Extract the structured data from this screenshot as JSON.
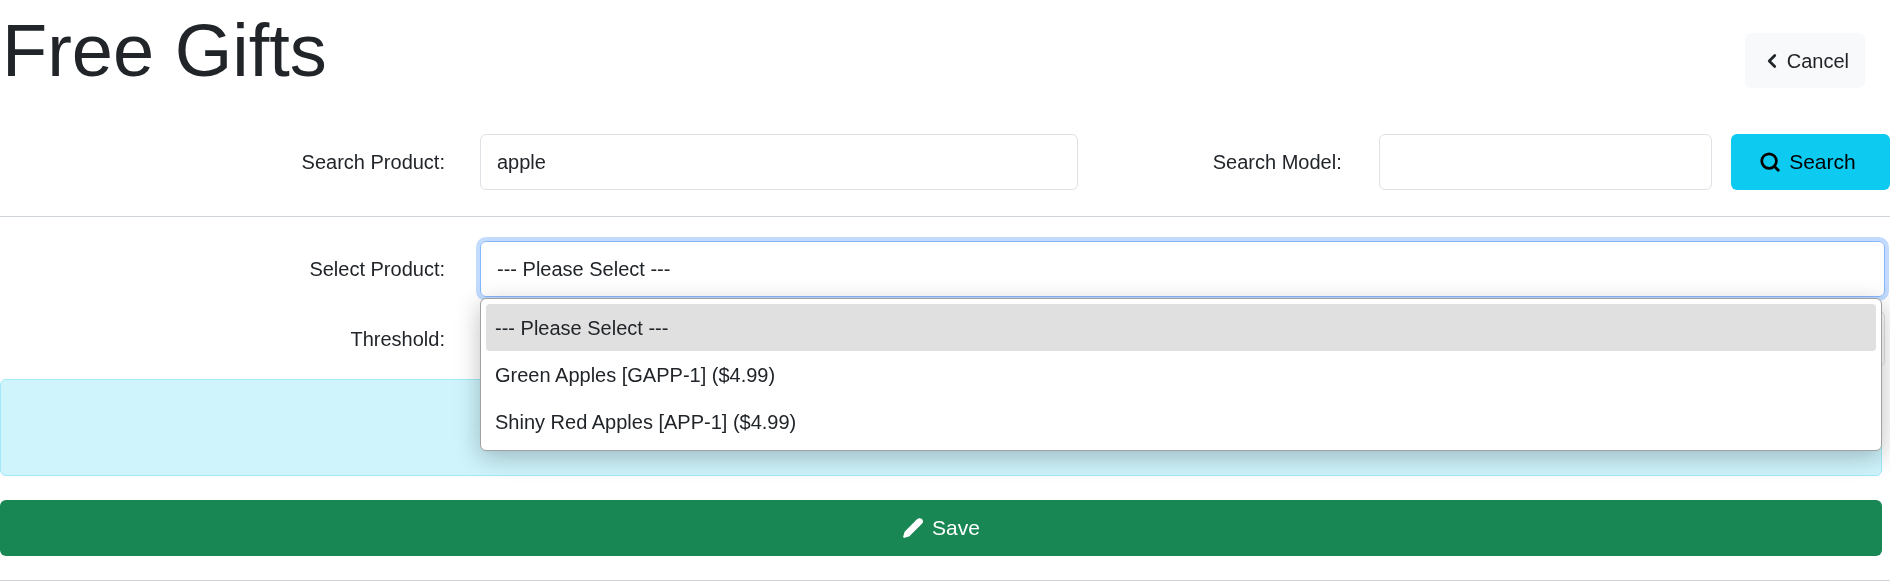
{
  "title": "Free Gifts",
  "cancel_button": {
    "label": "Cancel"
  },
  "search_product": {
    "label": "Search Product:",
    "value": "apple"
  },
  "search_model": {
    "label": "Search Model:"
  },
  "search_button": {
    "label": "Search"
  },
  "select_product": {
    "label": "Select Product:",
    "value": "--- Please Select ---",
    "expanded": true,
    "options": [
      {
        "label": "--- Please Select ---",
        "selected": true
      },
      {
        "label": "Green Apples [GAPP-1] ($4.99)",
        "selected": false
      },
      {
        "label": "Shiny Red Apples [APP-1] ($4.99)",
        "selected": false
      }
    ]
  },
  "threshold": {
    "label": "Threshold:"
  },
  "save_button": {
    "label": "Save"
  }
}
